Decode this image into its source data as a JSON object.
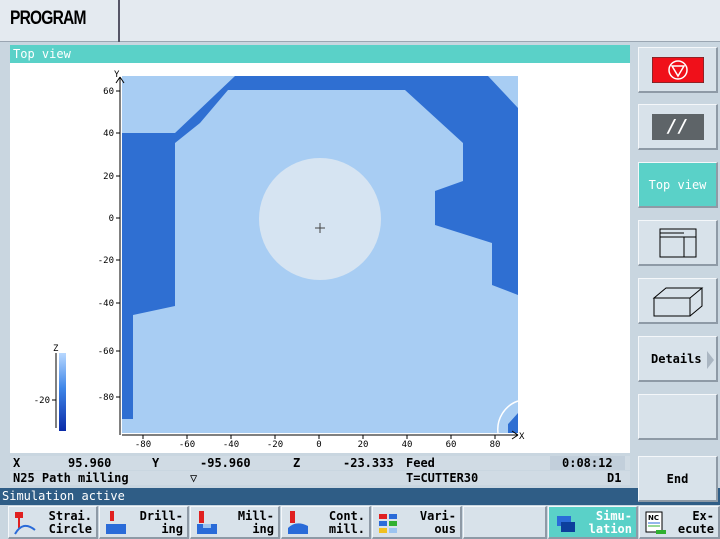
{
  "header": {
    "title": "PROGRAM"
  },
  "view": {
    "title": "Top view"
  },
  "plot": {
    "y_axis_label": "Y",
    "x_axis_label": "X",
    "z_axis_label": "Z",
    "y_ticks": [
      "60",
      "40",
      "20",
      "0",
      "-20",
      "-40",
      "-60",
      "-80"
    ],
    "x_ticks": [
      "-80",
      "-60",
      "-40",
      "-20",
      "0",
      "20",
      "40",
      "60",
      "80"
    ],
    "z_tick": "-20",
    "colors": {
      "light": "#a8cdf3",
      "dark": "#2f6fd2",
      "circle": "#d6e4f2"
    }
  },
  "status": {
    "x_label": "X",
    "x_value": "95.960",
    "y_label": "Y",
    "y_value": "-95.960",
    "z_label": "Z",
    "z_value": "-23.333",
    "feed_label": "Feed",
    "time": "0:08:12",
    "block": "N25 Path milling",
    "marker": "▽",
    "tool": "T=CUTTER30",
    "d_number": "D1"
  },
  "message": "Simulation active",
  "right_softkeys": [
    {
      "label": "",
      "icon": "stop-icon"
    },
    {
      "label": "//",
      "icon": "single-block-icon"
    },
    {
      "label": "Top view"
    },
    {
      "label": "",
      "icon": "three-plane-view-icon"
    },
    {
      "label": "",
      "icon": "3d-view-icon"
    },
    {
      "label": "Details"
    },
    {
      "label": ""
    },
    {
      "label": "End"
    }
  ],
  "bottom_softkeys": [
    {
      "label": "Strai.\nCircle"
    },
    {
      "label": "Drill-\ning"
    },
    {
      "label": "Mill-\ning"
    },
    {
      "label": "Cont.\nmill."
    },
    {
      "label": "Vari-\nous"
    },
    {
      "label": ""
    },
    {
      "label": "Simu-\nlation"
    },
    {
      "label": "Ex-\necute"
    }
  ]
}
